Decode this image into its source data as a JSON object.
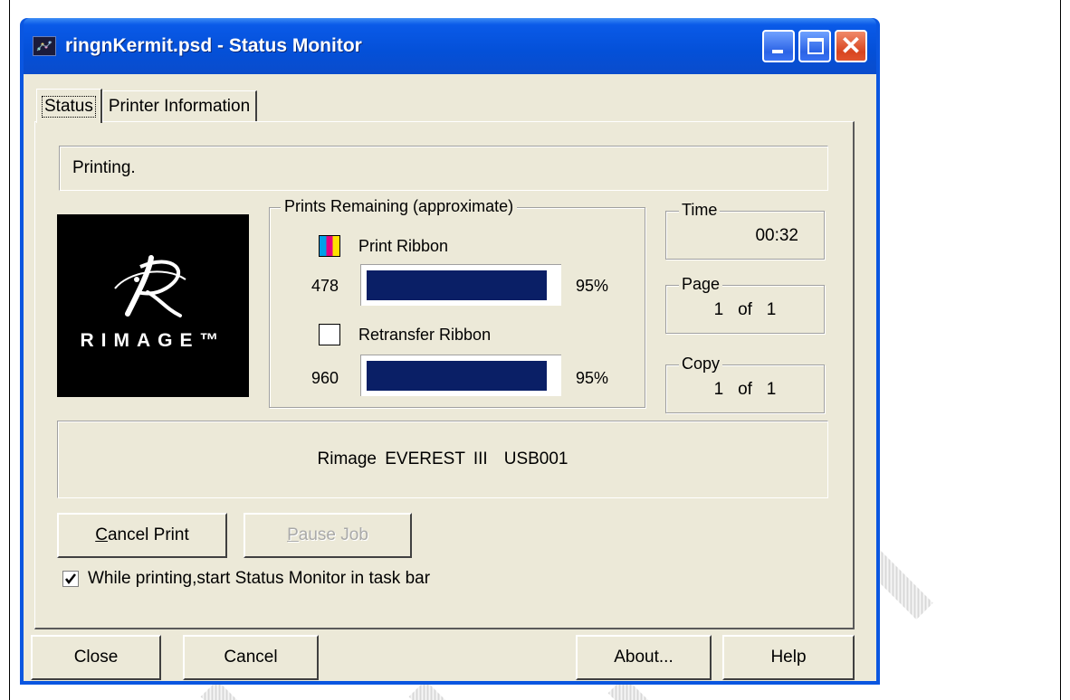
{
  "window": {
    "title": "ringnKermit.psd - Status Monitor"
  },
  "tabs": [
    {
      "label": "Status"
    },
    {
      "label": "Printer Information"
    }
  ],
  "status": {
    "message": "Printing."
  },
  "logo": {
    "brand": "RIMAGE™"
  },
  "prints_remaining": {
    "legend": "Prints Remaining (approximate)",
    "ribbons": [
      {
        "label": "Print Ribbon",
        "count": "478",
        "percent_text": "95%",
        "fill_fraction": 0.95
      },
      {
        "label": "Retransfer Ribbon",
        "count": "960",
        "percent_text": "95%",
        "fill_fraction": 0.95
      }
    ]
  },
  "time": {
    "legend": "Time",
    "value": "00:32"
  },
  "page": {
    "legend": "Page",
    "current": "1",
    "of": "of",
    "total": "1"
  },
  "copy": {
    "legend": "Copy",
    "current": "1",
    "of": "of",
    "total": "1"
  },
  "device": {
    "name": "Rimage EVEREST III",
    "port": "USB001"
  },
  "actions": {
    "cancel_print_first": "C",
    "cancel_print_rest": "ancel Print",
    "pause_job_first": "P",
    "pause_job_rest": "ause Job"
  },
  "checkbox": {
    "label": "While printing,start Status Monitor in task bar",
    "checked": true
  },
  "footer": {
    "close": "Close",
    "cancel": "Cancel",
    "about": "About...",
    "help": "Help"
  },
  "colors": {
    "titlebar": "#0a56e0",
    "dialog_bg": "#ece9d8",
    "progress_fill": "#0a1f66",
    "close_button": "#d8451f"
  }
}
